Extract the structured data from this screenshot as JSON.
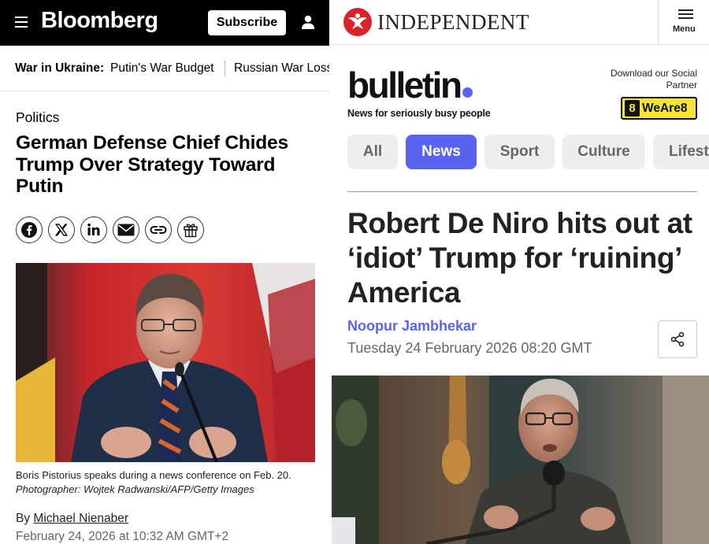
{
  "bloomberg": {
    "logo": "Bloomberg",
    "subscribe_label": "Subscribe",
    "topic_label": "War in Ukraine:",
    "topic_links": [
      "Putin's War Budget",
      "Russian War Loss"
    ],
    "section": "Politics",
    "headline": "German Defense Chief Chides Trump Over Strategy Toward Putin",
    "caption_text": "Boris Pistorius speaks during a news conference on Feb. 20.",
    "caption_credit": "Photographer: Wojtek Radwanski/AFP/Getty Images",
    "byline_prefix": "By",
    "author": "Michael Nienaber",
    "date": "February 24, 2026 at 10:32 AM GMT+2",
    "icons": [
      "facebook-icon",
      "x-icon",
      "linkedin-icon",
      "email-icon",
      "link-icon",
      "gift-icon"
    ]
  },
  "independent": {
    "logo": "INDEPENDENT",
    "menu_label": "Menu",
    "bulletin_logo": "bulletin",
    "bulletin_tagline": "News for seriously busy people",
    "download_text": "Download our Social Partner",
    "partner_number": "8",
    "partner_name": "WeAre8",
    "tabs": [
      "All",
      "News",
      "Sport",
      "Culture",
      "Lifest"
    ],
    "active_tab": "News",
    "headline": "Robert De Niro hits out at ‘idiot’ Trump for ‘ruining’ America",
    "author": "Noopur Jambhekar",
    "date": "Tuesday 24 February 2026 08:20 GMT",
    "accent_color": "#5a63f0"
  }
}
